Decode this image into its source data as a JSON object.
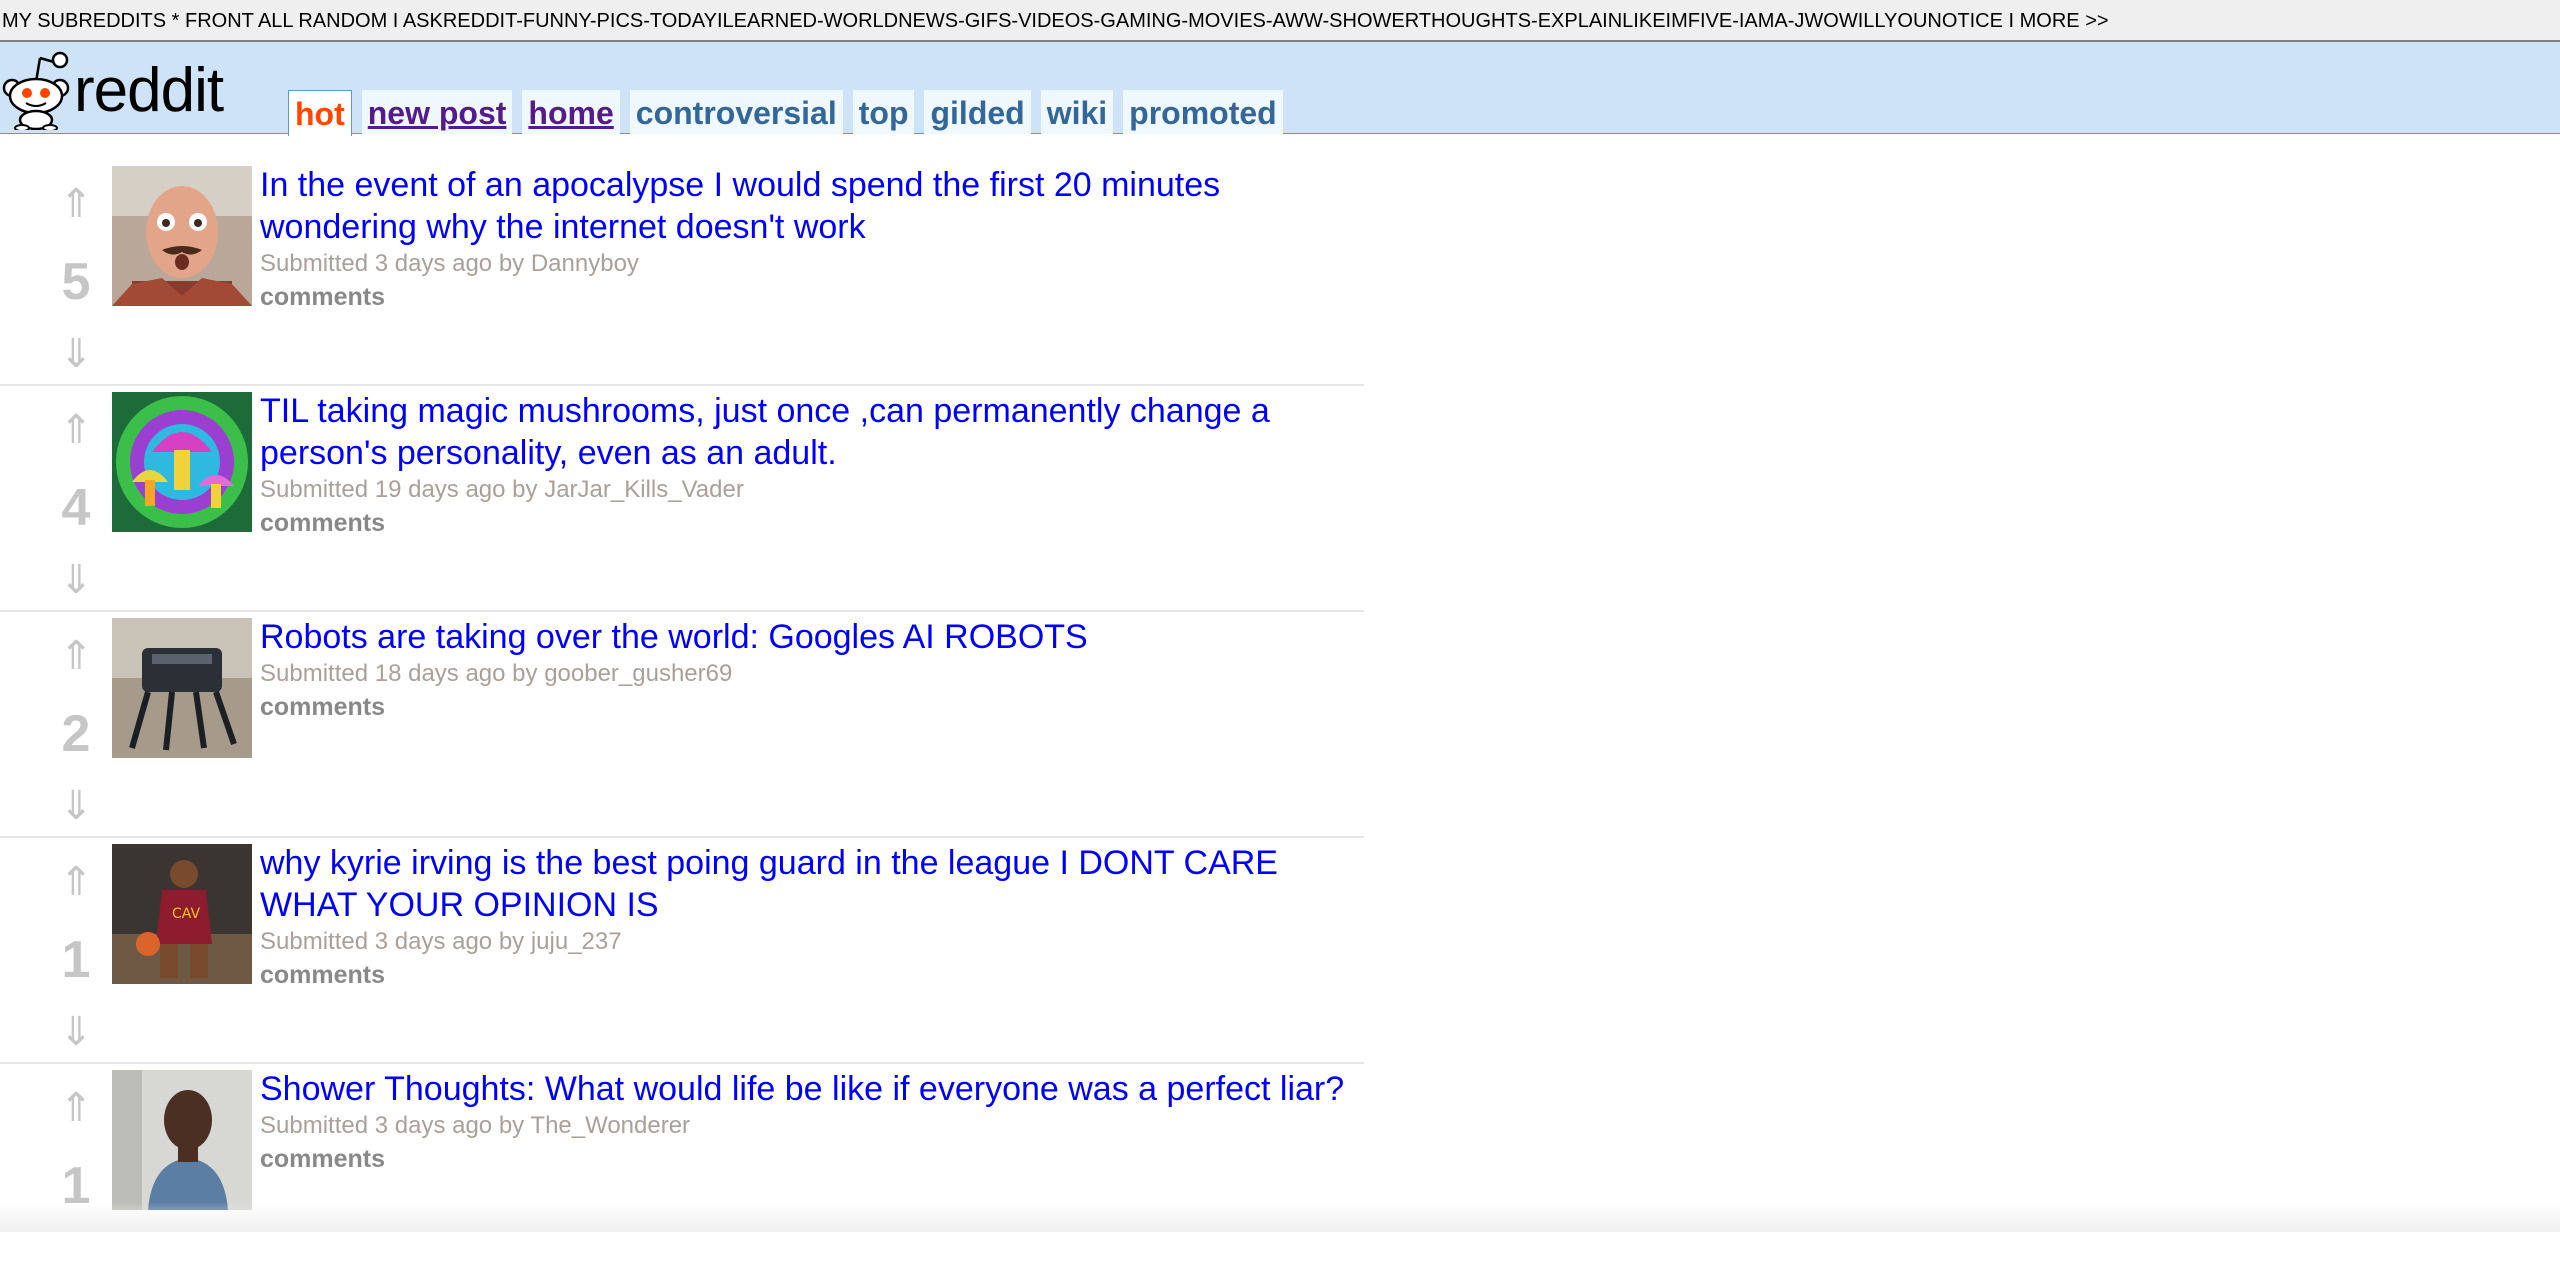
{
  "srbar": {
    "prefix": "MY SUBREDDITS * FRONT ALL RANDOM I ",
    "subs": "ASKREDDIT-FUNNY-PICS-TODAYILEARNED-WORLDNEWS-GIFS-VIDEOS-GAMING-MOVIES-AWW-SHOWERTHOUGHTS-EXPLAINLIKEIMFIVE-IAMA-JWOWILLYOUNOTICE",
    "more": " I MORE >>"
  },
  "header": {
    "logo_text": "reddit",
    "tabs": [
      {
        "label": "hot"
      },
      {
        "label": "new post"
      },
      {
        "label": "home"
      },
      {
        "label": "controversial"
      },
      {
        "label": "top"
      },
      {
        "label": "gilded"
      },
      {
        "label": "wiki"
      },
      {
        "label": "promoted"
      }
    ]
  },
  "posts": [
    {
      "score": "5",
      "title": "In the event of an apocalypse I would spend the first 20 minutes wondering why the internet doesn't work",
      "submitted": "Submitted 3 days ago by ",
      "author": "Dannyboy",
      "comments": "comments"
    },
    {
      "score": "4",
      "title": "TIL taking magic mushrooms, just once ,can permanently change a person's personality, even as an adult.",
      "submitted": "Submitted 19 days ago by ",
      "author": "JarJar_Kills_Vader",
      "comments": "comments"
    },
    {
      "score": "2",
      "title": "Robots are taking over the world: Googles AI ROBOTS",
      "submitted": "Submitted 18 days ago by ",
      "author": "goober_gusher69",
      "comments": "comments"
    },
    {
      "score": "1",
      "title": "why kyrie irving is the best poing guard in the league I DONT CARE WHAT YOUR OPINION IS",
      "submitted": "Submitted 3 days ago by ",
      "author": "juju_237",
      "comments": "comments"
    },
    {
      "score": "1",
      "title": "Shower Thoughts: What would life be like if everyone was a perfect liar?",
      "submitted": "Submitted 3 days ago by ",
      "author": "The_Wonderer",
      "comments": "comments"
    }
  ],
  "vote": {
    "up": "⇑",
    "down": "⇓"
  }
}
